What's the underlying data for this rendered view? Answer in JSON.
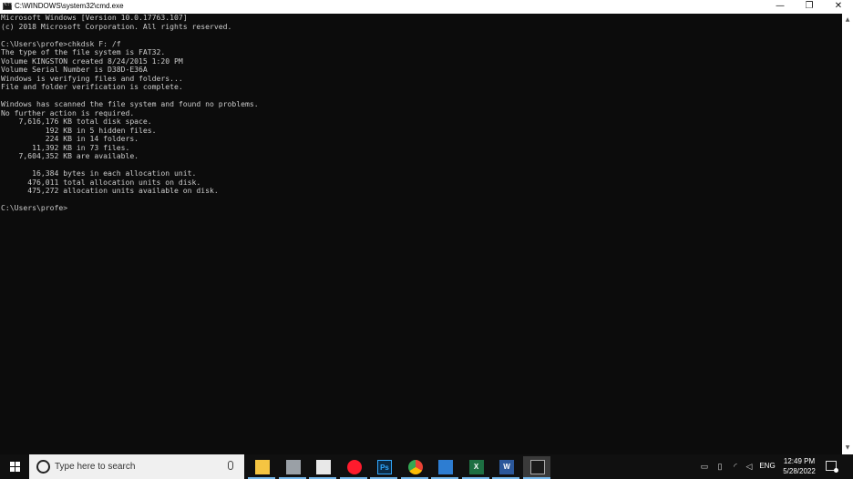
{
  "window": {
    "title": "C:\\WINDOWS\\system32\\cmd.exe",
    "minimize_glyph": "—",
    "restore_glyph": "❐",
    "close_glyph": "✕"
  },
  "console": {
    "lines": [
      "Microsoft Windows [Version 10.0.17763.107]",
      "(c) 2018 Microsoft Corporation. All rights reserved.",
      "",
      "C:\\Users\\profe>chkdsk F: /f",
      "The type of the file system is FAT32.",
      "Volume KINGSTON created 8/24/2015 1:20 PM",
      "Volume Serial Number is D38D-E36A",
      "Windows is verifying files and folders...",
      "File and folder verification is complete.",
      "",
      "Windows has scanned the file system and found no problems.",
      "No further action is required.",
      "    7,616,176 KB total disk space.",
      "          192 KB in 5 hidden files.",
      "          224 KB in 14 folders.",
      "       11,392 KB in 73 files.",
      "    7,604,352 KB are available.",
      "",
      "       16,384 bytes in each allocation unit.",
      "      476,011 total allocation units on disk.",
      "      475,272 allocation units available on disk.",
      "",
      "C:\\Users\\profe>"
    ]
  },
  "taskbar": {
    "search_placeholder": "Type here to search",
    "pinned": [
      {
        "name": "file-explorer-icon",
        "color": "#f5c542",
        "glyph": ""
      },
      {
        "name": "photos-icon",
        "color": "#9aa0a6",
        "glyph": ""
      },
      {
        "name": "paint-icon",
        "color": "#e8e8e8",
        "glyph": ""
      },
      {
        "name": "opera-icon",
        "color": "#ff1b2d",
        "glyph": ""
      },
      {
        "name": "photoshop-icon",
        "color": "#0b2a44",
        "glyph": "Ps"
      },
      {
        "name": "chrome-icon",
        "color": "#34a853",
        "glyph": ""
      },
      {
        "name": "window-app-icon",
        "color": "#2d7dd2",
        "glyph": ""
      },
      {
        "name": "excel-icon",
        "color": "#1d6f42",
        "glyph": "X"
      },
      {
        "name": "word-icon",
        "color": "#2b579a",
        "glyph": "W"
      },
      {
        "name": "cmd-icon",
        "color": "#1a1a1a",
        "glyph": ""
      }
    ],
    "language": "ENG",
    "time": "12:49 PM",
    "date": "5/28/2022"
  }
}
